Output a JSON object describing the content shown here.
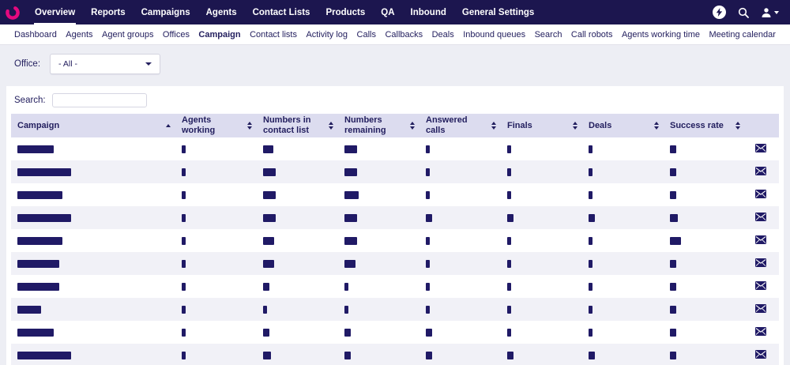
{
  "colors": {
    "topnav_bg": "#1c164f",
    "accent_pink": "#e5097f",
    "table_header_bg": "#dcdcef",
    "redaction_navy": "#201a66",
    "page_bg": "#edeef4"
  },
  "topnav": {
    "items": [
      {
        "label": "Overview",
        "active": true
      },
      {
        "label": "Reports",
        "active": false
      },
      {
        "label": "Campaigns",
        "active": false
      },
      {
        "label": "Agents",
        "active": false
      },
      {
        "label": "Contact Lists",
        "active": false
      },
      {
        "label": "Products",
        "active": false
      },
      {
        "label": "QA",
        "active": false
      },
      {
        "label": "Inbound",
        "active": false
      },
      {
        "label": "General Settings",
        "active": false
      }
    ],
    "right_icons": [
      "bolt-icon",
      "search-icon",
      "user-menu-icon"
    ]
  },
  "subnav": {
    "items": [
      {
        "label": "Dashboard",
        "active": false
      },
      {
        "label": "Agents",
        "active": false
      },
      {
        "label": "Agent groups",
        "active": false
      },
      {
        "label": "Offices",
        "active": false
      },
      {
        "label": "Campaign",
        "active": true
      },
      {
        "label": "Contact lists",
        "active": false
      },
      {
        "label": "Activity log",
        "active": false
      },
      {
        "label": "Calls",
        "active": false
      },
      {
        "label": "Callbacks",
        "active": false
      },
      {
        "label": "Deals",
        "active": false
      },
      {
        "label": "Inbound queues",
        "active": false
      },
      {
        "label": "Search",
        "active": false
      },
      {
        "label": "Call robots",
        "active": false
      },
      {
        "label": "Agents working time",
        "active": false
      },
      {
        "label": "Meeting calendar",
        "active": false
      }
    ]
  },
  "filter": {
    "office_label": "Office:",
    "office_value": "- All -"
  },
  "search": {
    "label": "Search:",
    "value": "",
    "placeholder": ""
  },
  "table": {
    "columns": [
      {
        "label": "Campaign",
        "sort": "asc"
      },
      {
        "label": "Agents working",
        "sort": "both"
      },
      {
        "label": "Numbers in contact list",
        "sort": "both"
      },
      {
        "label": "Numbers remaining",
        "sort": "both"
      },
      {
        "label": "Answered calls",
        "sort": "both"
      },
      {
        "label": "Finals",
        "sort": "both"
      },
      {
        "label": "Deals",
        "sort": "both"
      },
      {
        "label": "Success rate",
        "sort": "both"
      },
      {
        "label": "",
        "sort": null
      }
    ],
    "rows": [
      {
        "campaign_redacted_width": 46,
        "cell_redacted_widths": [
          5,
          13,
          16,
          5,
          5,
          5,
          8
        ]
      },
      {
        "campaign_redacted_width": 68,
        "cell_redacted_widths": [
          5,
          16,
          16,
          5,
          5,
          5,
          8
        ]
      },
      {
        "campaign_redacted_width": 57,
        "cell_redacted_widths": [
          5,
          16,
          18,
          5,
          5,
          5,
          8
        ]
      },
      {
        "campaign_redacted_width": 68,
        "cell_redacted_widths": [
          5,
          16,
          16,
          8,
          8,
          8,
          10
        ]
      },
      {
        "campaign_redacted_width": 57,
        "cell_redacted_widths": [
          5,
          14,
          16,
          5,
          5,
          5,
          14
        ]
      },
      {
        "campaign_redacted_width": 53,
        "cell_redacted_widths": [
          5,
          14,
          14,
          5,
          5,
          5,
          8
        ]
      },
      {
        "campaign_redacted_width": 53,
        "cell_redacted_widths": [
          5,
          8,
          5,
          5,
          5,
          5,
          8
        ]
      },
      {
        "campaign_redacted_width": 30,
        "cell_redacted_widths": [
          5,
          5,
          5,
          5,
          5,
          5,
          8
        ]
      },
      {
        "campaign_redacted_width": 46,
        "cell_redacted_widths": [
          5,
          8,
          8,
          8,
          5,
          5,
          8
        ]
      },
      {
        "campaign_redacted_width": 68,
        "cell_redacted_widths": [
          5,
          10,
          8,
          8,
          8,
          8,
          8
        ]
      }
    ]
  }
}
